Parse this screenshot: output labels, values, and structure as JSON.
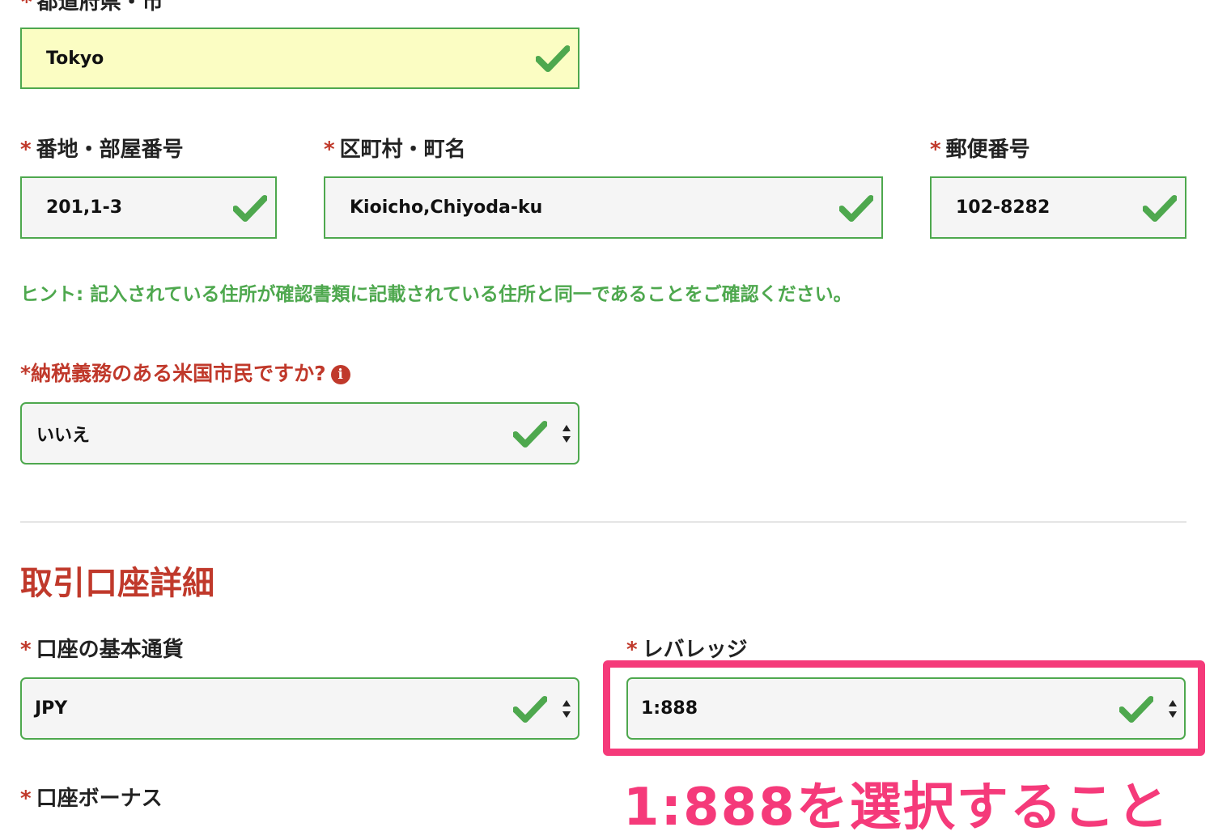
{
  "prefecture": {
    "label": "都道府県・市",
    "value": "Tokyo"
  },
  "address_row": {
    "street": {
      "label": "番地・部屋番号",
      "value": "201,1-3"
    },
    "town": {
      "label": "区町村・町名",
      "value": "Kioicho,Chiyoda-ku"
    },
    "postal": {
      "label": "郵便番号",
      "value": "102-8282"
    }
  },
  "required_mark": "*",
  "hint": "ヒント: 記入されている住所が確認書類に記載されている住所と同一であることをご確認ください。",
  "us_citizen": {
    "question": "*納税義務のある米国市民ですか?",
    "info_glyph": "i",
    "selected": "いいえ"
  },
  "account_section": {
    "title": "取引口座詳細",
    "currency": {
      "label": "口座の基本通貨",
      "selected": "JPY"
    },
    "leverage": {
      "label": "レバレッジ",
      "selected": "1:888"
    },
    "bonus": {
      "label": "口座ボーナス"
    }
  },
  "annotation": {
    "text": "1:888を選択すること",
    "color": "#f53a7a"
  },
  "colors": {
    "valid_border": "#4ea84e",
    "required": "#c0392b",
    "hint": "#4ea84e",
    "autofill_bg": "#fbfdc3"
  }
}
